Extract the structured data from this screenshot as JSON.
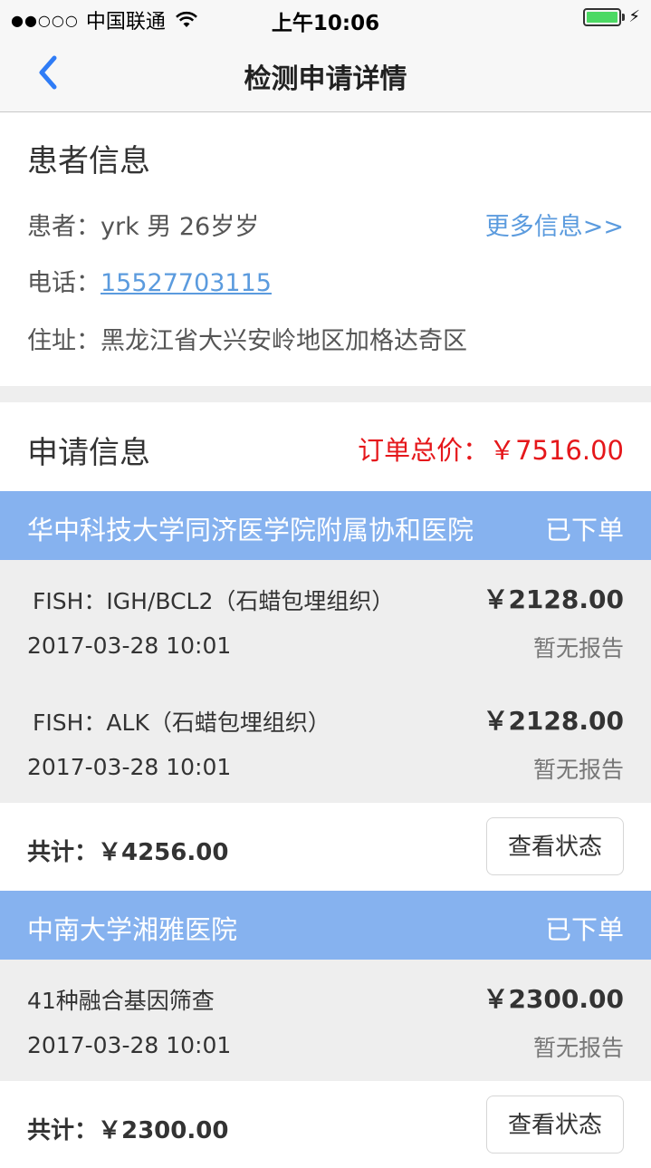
{
  "status_bar": {
    "signal": "●●○○○",
    "carrier": "中国联通",
    "time": "上午10:06",
    "battery_level": 1.0,
    "battery_color": "#4cd964"
  },
  "nav": {
    "back_icon": "chevron-left-icon",
    "title": "检测申请详情"
  },
  "patient": {
    "title": "患者信息",
    "name_line": "患者：yrk  男  26岁岁",
    "more_link": "更多信息>>",
    "phone_label": "电话：",
    "phone": "15527703115",
    "address": "住址：黑龙江省大兴安岭地区加格达奇区"
  },
  "application": {
    "title": "申请信息",
    "total": "订单总价：￥7516.00",
    "total_color": "#e5171b"
  },
  "hospitals": [
    {
      "name": "华中科技大学同济医学院附属协和医院",
      "status": "已下单",
      "items": [
        {
          "name": "FISH：IGH/BCL2（石蜡包埋组织）",
          "price": "￥2128.00",
          "date": "2017-03-28 10:01",
          "report": "暂无报告"
        },
        {
          "name": "FISH：ALK（石蜡包埋组织）",
          "price": "￥2128.00",
          "date": "2017-03-28 10:01",
          "report": "暂无报告"
        }
      ],
      "subtotal": "共计：￥4256.00",
      "button": "查看状态"
    },
    {
      "name": "中南大学湘雅医院",
      "status": "已下单",
      "items": [
        {
          "name": "41种融合基因筛查",
          "price": "￥2300.00",
          "date": "2017-03-28 10:01",
          "report": "暂无报告"
        }
      ],
      "subtotal": "共计：￥2300.00",
      "button": "查看状态"
    }
  ],
  "colors": {
    "accent_link": "#5b9bde",
    "hospital_header": "#86b2ef"
  }
}
